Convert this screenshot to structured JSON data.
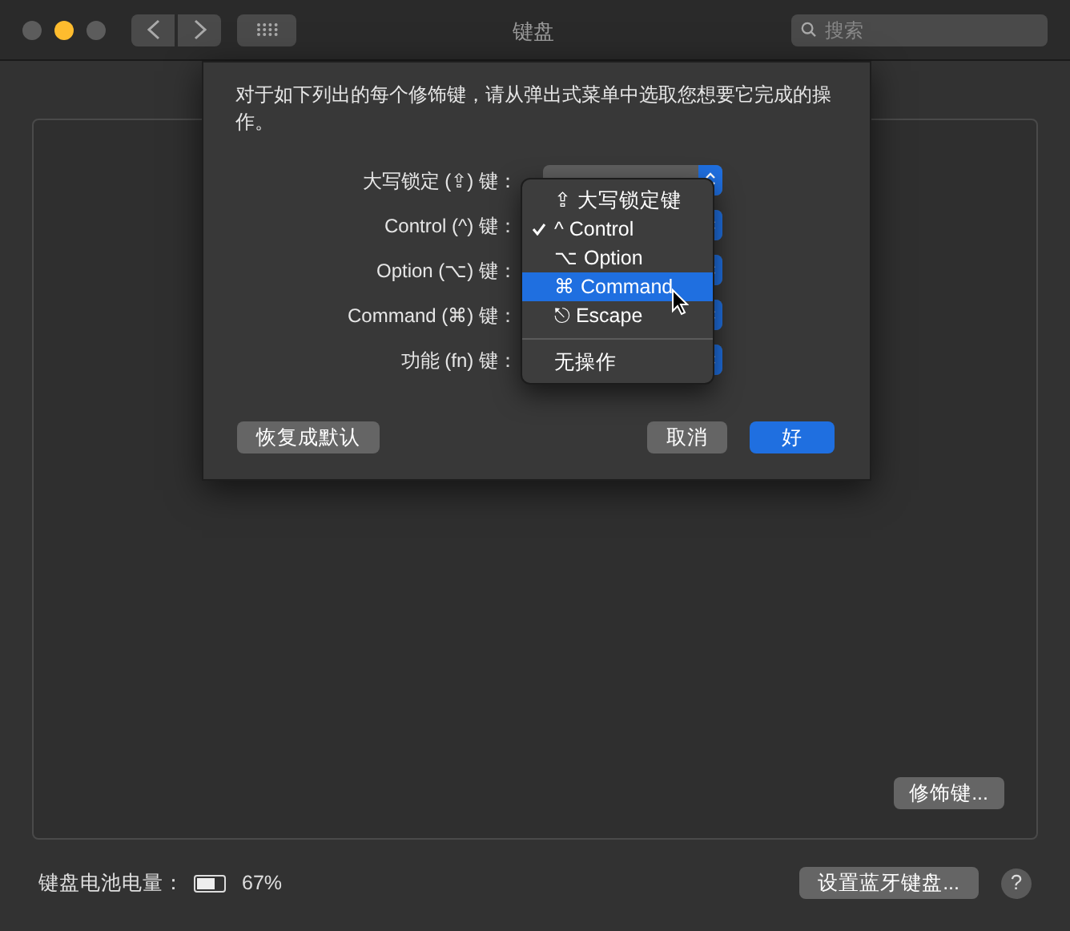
{
  "window": {
    "title": "键盘",
    "traffic_lights": [
      {
        "color": "#5c5c5c"
      },
      {
        "color": "#febc2e"
      },
      {
        "color": "#5c5c5c"
      }
    ],
    "search": {
      "placeholder": "搜索"
    }
  },
  "sheet": {
    "instruction": "对于如下列出的每个修饰键，请从弹出式菜单中选取您想要它完成的操作。",
    "rows": [
      {
        "label": "大写锁定 (⇪) 键："
      },
      {
        "label": "Control (^) 键："
      },
      {
        "label": "Option (⌥) 键："
      },
      {
        "label": "Command (⌘) 键："
      },
      {
        "label": "功能 (fn) 键："
      }
    ],
    "menu": [
      {
        "kind": "option",
        "label": "⇪ 大写锁定键",
        "checked": false,
        "selected": false
      },
      {
        "kind": "option",
        "label": "^ Control",
        "checked": true,
        "selected": false
      },
      {
        "kind": "option",
        "label": "⌥ Option",
        "checked": false,
        "selected": false
      },
      {
        "kind": "option",
        "label": "⌘ Command",
        "checked": false,
        "selected": true
      },
      {
        "kind": "option",
        "label": "⎋ Escape",
        "checked": false,
        "selected": false
      },
      {
        "kind": "separator"
      },
      {
        "kind": "option",
        "label": "无操作",
        "checked": false,
        "selected": false
      }
    ],
    "buttons": [
      {
        "label": "恢复成默认",
        "kind": "secondary"
      },
      {
        "label": "取消",
        "kind": "secondary"
      },
      {
        "label": "好",
        "kind": "primary"
      }
    ]
  },
  "panel": {
    "modifier_button": "修饰键..."
  },
  "footer": {
    "battery_label": "键盘电池电量：",
    "battery": {
      "level": 0.67
    },
    "battery_reading": "67%",
    "setup_button": "设置蓝牙键盘...",
    "help_button": "?"
  }
}
